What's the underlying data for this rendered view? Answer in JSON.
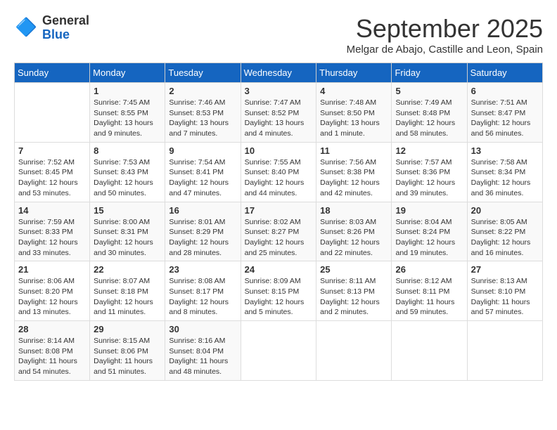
{
  "header": {
    "logo": {
      "general": "General",
      "blue": "Blue",
      "icon": "🔷"
    },
    "title": "September 2025",
    "subtitle": "Melgar de Abajo, Castille and Leon, Spain"
  },
  "weekdays": [
    "Sunday",
    "Monday",
    "Tuesday",
    "Wednesday",
    "Thursday",
    "Friday",
    "Saturday"
  ],
  "weeks": [
    [
      {
        "day": "",
        "info": ""
      },
      {
        "day": "1",
        "info": "Sunrise: 7:45 AM\nSunset: 8:55 PM\nDaylight: 13 hours\nand 9 minutes."
      },
      {
        "day": "2",
        "info": "Sunrise: 7:46 AM\nSunset: 8:53 PM\nDaylight: 13 hours\nand 7 minutes."
      },
      {
        "day": "3",
        "info": "Sunrise: 7:47 AM\nSunset: 8:52 PM\nDaylight: 13 hours\nand 4 minutes."
      },
      {
        "day": "4",
        "info": "Sunrise: 7:48 AM\nSunset: 8:50 PM\nDaylight: 13 hours\nand 1 minute."
      },
      {
        "day": "5",
        "info": "Sunrise: 7:49 AM\nSunset: 8:48 PM\nDaylight: 12 hours\nand 58 minutes."
      },
      {
        "day": "6",
        "info": "Sunrise: 7:51 AM\nSunset: 8:47 PM\nDaylight: 12 hours\nand 56 minutes."
      }
    ],
    [
      {
        "day": "7",
        "info": "Sunrise: 7:52 AM\nSunset: 8:45 PM\nDaylight: 12 hours\nand 53 minutes."
      },
      {
        "day": "8",
        "info": "Sunrise: 7:53 AM\nSunset: 8:43 PM\nDaylight: 12 hours\nand 50 minutes."
      },
      {
        "day": "9",
        "info": "Sunrise: 7:54 AM\nSunset: 8:41 PM\nDaylight: 12 hours\nand 47 minutes."
      },
      {
        "day": "10",
        "info": "Sunrise: 7:55 AM\nSunset: 8:40 PM\nDaylight: 12 hours\nand 44 minutes."
      },
      {
        "day": "11",
        "info": "Sunrise: 7:56 AM\nSunset: 8:38 PM\nDaylight: 12 hours\nand 42 minutes."
      },
      {
        "day": "12",
        "info": "Sunrise: 7:57 AM\nSunset: 8:36 PM\nDaylight: 12 hours\nand 39 minutes."
      },
      {
        "day": "13",
        "info": "Sunrise: 7:58 AM\nSunset: 8:34 PM\nDaylight: 12 hours\nand 36 minutes."
      }
    ],
    [
      {
        "day": "14",
        "info": "Sunrise: 7:59 AM\nSunset: 8:33 PM\nDaylight: 12 hours\nand 33 minutes."
      },
      {
        "day": "15",
        "info": "Sunrise: 8:00 AM\nSunset: 8:31 PM\nDaylight: 12 hours\nand 30 minutes."
      },
      {
        "day": "16",
        "info": "Sunrise: 8:01 AM\nSunset: 8:29 PM\nDaylight: 12 hours\nand 28 minutes."
      },
      {
        "day": "17",
        "info": "Sunrise: 8:02 AM\nSunset: 8:27 PM\nDaylight: 12 hours\nand 25 minutes."
      },
      {
        "day": "18",
        "info": "Sunrise: 8:03 AM\nSunset: 8:26 PM\nDaylight: 12 hours\nand 22 minutes."
      },
      {
        "day": "19",
        "info": "Sunrise: 8:04 AM\nSunset: 8:24 PM\nDaylight: 12 hours\nand 19 minutes."
      },
      {
        "day": "20",
        "info": "Sunrise: 8:05 AM\nSunset: 8:22 PM\nDaylight: 12 hours\nand 16 minutes."
      }
    ],
    [
      {
        "day": "21",
        "info": "Sunrise: 8:06 AM\nSunset: 8:20 PM\nDaylight: 12 hours\nand 13 minutes."
      },
      {
        "day": "22",
        "info": "Sunrise: 8:07 AM\nSunset: 8:18 PM\nDaylight: 12 hours\nand 11 minutes."
      },
      {
        "day": "23",
        "info": "Sunrise: 8:08 AM\nSunset: 8:17 PM\nDaylight: 12 hours\nand 8 minutes."
      },
      {
        "day": "24",
        "info": "Sunrise: 8:09 AM\nSunset: 8:15 PM\nDaylight: 12 hours\nand 5 minutes."
      },
      {
        "day": "25",
        "info": "Sunrise: 8:11 AM\nSunset: 8:13 PM\nDaylight: 12 hours\nand 2 minutes."
      },
      {
        "day": "26",
        "info": "Sunrise: 8:12 AM\nSunset: 8:11 PM\nDaylight: 11 hours\nand 59 minutes."
      },
      {
        "day": "27",
        "info": "Sunrise: 8:13 AM\nSunset: 8:10 PM\nDaylight: 11 hours\nand 57 minutes."
      }
    ],
    [
      {
        "day": "28",
        "info": "Sunrise: 8:14 AM\nSunset: 8:08 PM\nDaylight: 11 hours\nand 54 minutes."
      },
      {
        "day": "29",
        "info": "Sunrise: 8:15 AM\nSunset: 8:06 PM\nDaylight: 11 hours\nand 51 minutes."
      },
      {
        "day": "30",
        "info": "Sunrise: 8:16 AM\nSunset: 8:04 PM\nDaylight: 11 hours\nand 48 minutes."
      },
      {
        "day": "",
        "info": ""
      },
      {
        "day": "",
        "info": ""
      },
      {
        "day": "",
        "info": ""
      },
      {
        "day": "",
        "info": ""
      }
    ]
  ]
}
